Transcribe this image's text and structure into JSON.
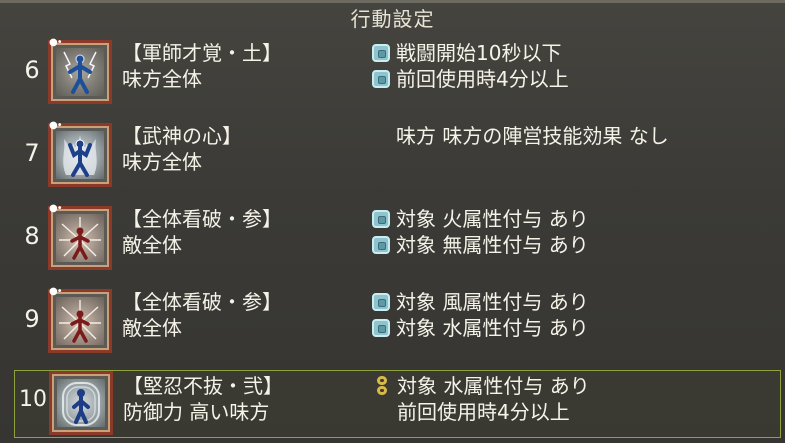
{
  "window": {
    "title": "行動設定"
  },
  "rows": [
    {
      "number": "6",
      "skill_name": "【軍師才覚・土】",
      "target": "味方全体",
      "conditions": [
        "戦闘開始10秒以下",
        "前回使用時4分以上"
      ],
      "icon": "blue-figure-lightning-icon"
    },
    {
      "number": "7",
      "skill_name": "【武神の心】",
      "target": "味方全体",
      "conditions": [
        "味方 味方の陣営技能効果 なし"
      ],
      "icon": "blue-figure-flame-aura-icon"
    },
    {
      "number": "8",
      "skill_name": "【全体看破・参】",
      "target": "敵全体",
      "conditions": [
        "対象 火属性付与 あり",
        "対象 無属性付与 あり"
      ],
      "icon": "red-figure-burst-icon"
    },
    {
      "number": "9",
      "skill_name": "【全体看破・参】",
      "target": "敵全体",
      "conditions": [
        "対象 風属性付与 あり",
        "対象 水属性付与 あり"
      ],
      "icon": "red-figure-burst-icon"
    },
    {
      "number": "10",
      "skill_name": "【堅忍不抜・弐】",
      "target": "防御力 高い味方",
      "conditions": [
        "対象 水属性付与 あり",
        "前回使用時4分以上"
      ],
      "icon": "blue-figure-shield-aura-icon"
    }
  ],
  "colors": {
    "selection_border": "#8ea23c",
    "bullet": "#8fc4cf",
    "chain_link": "#d7b94a",
    "icon_frame": "#8b3a2a"
  }
}
